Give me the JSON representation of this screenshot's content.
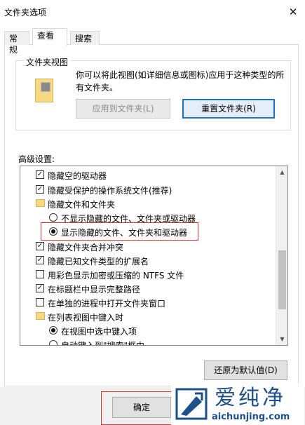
{
  "window": {
    "title": "文件夹选项"
  },
  "tabs": [
    {
      "label": "常规",
      "active": false
    },
    {
      "label": "查看",
      "active": true
    },
    {
      "label": "搜索",
      "active": false
    }
  ],
  "folder_views": {
    "group_label": "文件夹视图",
    "description": "你可以将此视图(如详细信息或图标)应用于这种类型的所有文件夹。",
    "apply_label": "应用到文件夹(L)",
    "reset_label": "重置文件夹(R)"
  },
  "advanced": {
    "label": "高级设置:",
    "items": [
      {
        "type": "checkbox",
        "checked": true,
        "indent": 0,
        "label": "隐藏空的驱动器"
      },
      {
        "type": "checkbox",
        "checked": true,
        "indent": 0,
        "label": "隐藏受保护的操作系统文件(推荐)"
      },
      {
        "type": "folder",
        "indent": 0,
        "label": "隐藏文件和文件夹"
      },
      {
        "type": "radio",
        "checked": false,
        "indent": 1,
        "label": "不显示隐藏的文件、文件夹或驱动器"
      },
      {
        "type": "radio",
        "checked": true,
        "indent": 1,
        "label": "显示隐藏的文件、文件夹和驱动器"
      },
      {
        "type": "checkbox",
        "checked": true,
        "indent": 0,
        "label": "隐藏文件夹合并冲突"
      },
      {
        "type": "checkbox",
        "checked": true,
        "indent": 0,
        "label": "隐藏已知文件类型的扩展名"
      },
      {
        "type": "checkbox",
        "checked": false,
        "indent": 0,
        "label": "用彩色显示加密或压缩的 NTFS 文件"
      },
      {
        "type": "checkbox",
        "checked": true,
        "indent": 0,
        "label": "在标题栏中显示完整路径"
      },
      {
        "type": "checkbox",
        "checked": false,
        "indent": 0,
        "label": "在单独的进程中打开文件夹窗口"
      },
      {
        "type": "folder",
        "indent": 0,
        "label": "在列表视图中键入时"
      },
      {
        "type": "radio",
        "checked": true,
        "indent": 1,
        "label": "在视图中选中键入项"
      },
      {
        "type": "radio",
        "checked": false,
        "indent": 1,
        "label": "自动键入到\"搜索\"框中"
      }
    ],
    "restore_label": "还原为默认值(D)"
  },
  "footer": {
    "ok_label": "确定"
  },
  "watermark": {
    "text": "爱纯净",
    "url": "aichunjing.com"
  },
  "colors": {
    "accent": "#1a73c8",
    "highlight": "#d93030",
    "watermark": "#1d4f8c"
  }
}
